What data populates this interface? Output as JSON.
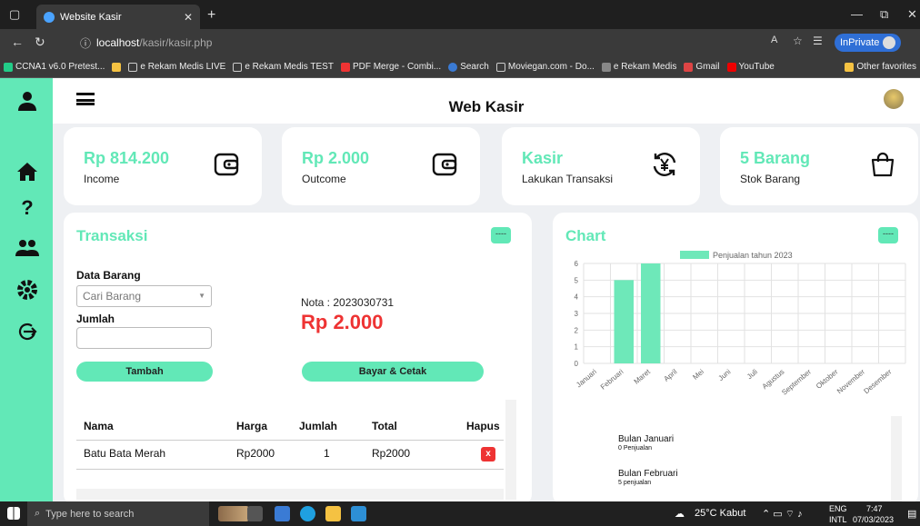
{
  "browser": {
    "tab_title": "Website Kasir",
    "url_host": "localhost",
    "url_path": "/kasir/kasir.php",
    "inprivate": "InPrivate",
    "bookmarks": [
      "CCNA1 v6.0 Pretest...",
      "e Rekam Medis LIVE",
      "e Rekam Medis TEST",
      "PDF Merge - Combi...",
      "Search",
      "Moviegan.com - Do...",
      "e Rekam Medis",
      "Gmail",
      "YouTube",
      "Other favorites"
    ]
  },
  "app": {
    "title": "Web Kasir"
  },
  "cards": [
    {
      "value": "Rp 814.200",
      "label": "Income",
      "icon": "wallet-icon"
    },
    {
      "value": "Rp 2.000",
      "label": "Outcome",
      "icon": "wallet-icon"
    },
    {
      "value": "Kasir",
      "label": "Lakukan Transaksi",
      "icon": "yen-cycle-icon"
    },
    {
      "value": "5 Barang",
      "label": "Stok Barang",
      "icon": "shopping-bag-icon"
    }
  ],
  "transaksi": {
    "title": "Transaksi",
    "menu_btn": "----",
    "data_barang_label": "Data Barang",
    "cari_placeholder": "Cari Barang",
    "jumlah_label": "Jumlah",
    "jumlah_value": "",
    "tambah_label": "Tambah",
    "nota": "Nota : 2023030731",
    "total": "Rp 2.000",
    "bayar_label": "Bayar & Cetak",
    "headers": [
      "Nama",
      "Harga",
      "Jumlah",
      "Total",
      "Hapus"
    ],
    "rows": [
      {
        "nama": "Batu Bata Merah",
        "harga": "Rp2000",
        "jumlah": "1",
        "total": "Rp2000",
        "hapus": "x"
      }
    ]
  },
  "chart_panel": {
    "title": "Chart",
    "menu_btn": "----",
    "bulan": [
      {
        "name": "Bulan Januari",
        "detail": "0 Penjualan"
      },
      {
        "name": "Bulan Februari",
        "detail": "5 penjualan"
      }
    ]
  },
  "chart_data": {
    "type": "bar",
    "legend": "Penjualan tahun 2023",
    "legend_position": "top-center",
    "categories": [
      "Januari",
      "Februari",
      "Maret",
      "April",
      "Mei",
      "Juni",
      "Juli",
      "Agustus",
      "September",
      "Oktober",
      "November",
      "Desember"
    ],
    "series": [
      {
        "name": "Penjualan tahun 2023",
        "values": [
          0,
          5,
          6,
          0,
          0,
          0,
          0,
          0,
          0,
          0,
          0,
          0
        ]
      }
    ],
    "ylim": [
      0,
      6
    ],
    "yticks": [
      0,
      1,
      2,
      3,
      4,
      5,
      6
    ],
    "grid": true,
    "color": "#6ee8b9"
  },
  "taskbar": {
    "search_placeholder": "Type here to search",
    "weather": "25°C Kabut",
    "lang": "ENG",
    "lang2": "INTL",
    "time": "7:47",
    "date": "07/03/2023"
  }
}
